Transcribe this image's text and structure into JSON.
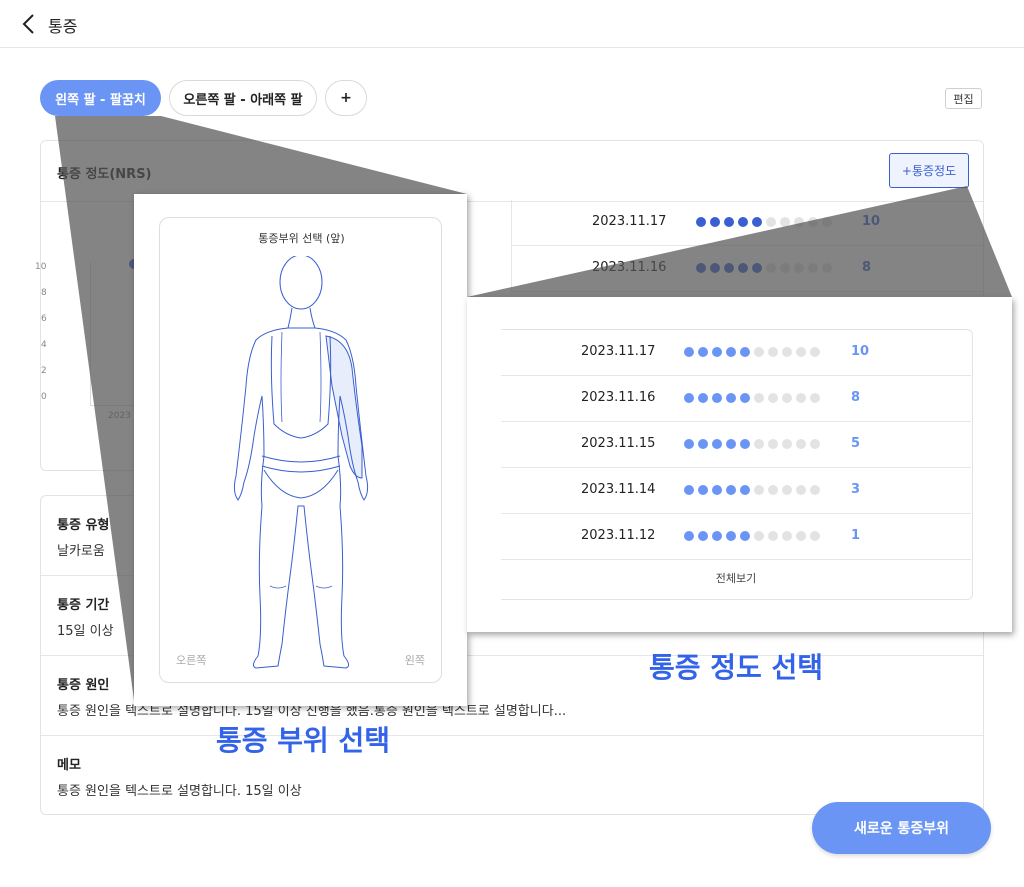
{
  "header": {
    "title": "통증"
  },
  "tabs": [
    {
      "label": "왼쪽 팔 - 팔꿈치",
      "active": true
    },
    {
      "label": "오른쪽 팔 - 아래쪽 팔",
      "active": false
    },
    {
      "label": "+",
      "active": false
    }
  ],
  "edit_label": "편집",
  "nrs": {
    "title": "통증 정도(NRS)",
    "add_label": "+통증정도",
    "chart": {
      "y_ticks": [
        "10",
        "8",
        "6",
        "4",
        "2",
        "0"
      ],
      "x_tick": "2023"
    },
    "rows": [
      {
        "date": "2023.11.17",
        "value": "10"
      },
      {
        "date": "2023.11.16",
        "value": "8"
      }
    ]
  },
  "info": [
    {
      "label": "통증 유형",
      "value": "날카로움"
    },
    {
      "label": "통증 기간",
      "value": "15일 이상"
    },
    {
      "label": "통증 원인",
      "value": "통증 원인을 텍스트로 설명합니다. 15일 이상 진행을 했음.통증 원인을 텍스트로 설명합니다..."
    },
    {
      "label": "메모",
      "value": "통증 원인을 텍스트로 설명합니다. 15일 이상"
    }
  ],
  "body_selector": {
    "title": "통증부위 선택 (앞)",
    "right_label": "오른쪽",
    "left_label": "왼쪽"
  },
  "nrs_popup": {
    "rows": [
      {
        "date": "2023.11.17",
        "value": "10"
      },
      {
        "date": "2023.11.16",
        "value": "8"
      },
      {
        "date": "2023.11.15",
        "value": "5"
      },
      {
        "date": "2023.11.14",
        "value": "3"
      },
      {
        "date": "2023.11.12",
        "value": "1"
      }
    ],
    "view_all": "전체보기"
  },
  "annotations": {
    "nrs_select": "통증 정도 선택",
    "body_select": "통증 부위 선택"
  },
  "fab_label": "새로운 통증부위",
  "colors": {
    "primary": "#6b95f5",
    "accent": "#3a5fd0",
    "annotation": "#3363e8",
    "dot_off": "#e3e3e3"
  }
}
